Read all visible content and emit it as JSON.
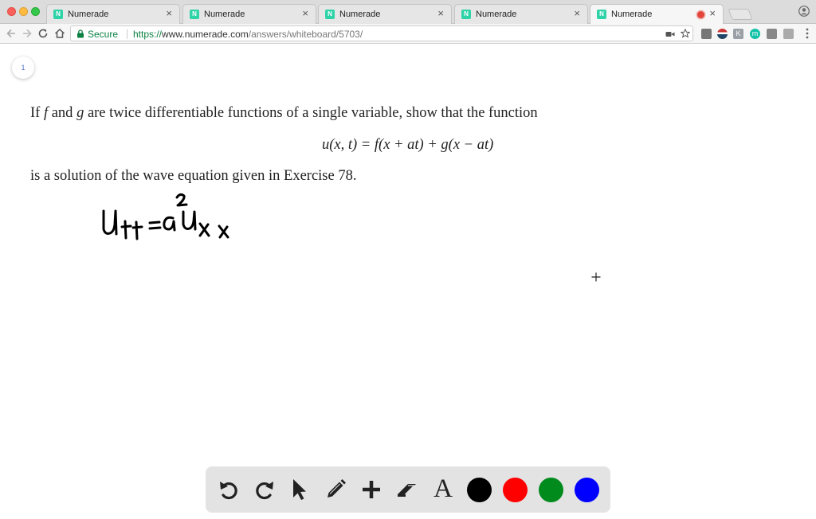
{
  "browser": {
    "tabs": [
      {
        "title": "Numerade",
        "favicon": "N"
      },
      {
        "title": "Numerade",
        "favicon": "N"
      },
      {
        "title": "Numerade",
        "favicon": "N"
      },
      {
        "title": "Numerade",
        "favicon": "N"
      },
      {
        "title": "Numerade",
        "favicon": "N",
        "active": true,
        "recording": true
      }
    ],
    "close_glyph": "×",
    "secure_label": "Secure",
    "url_scheme": "https://",
    "url_host": "www.numerade.com",
    "url_path": "/answers/whiteboard/5703/",
    "extensions": [
      "K",
      "m"
    ],
    "accent_secure": "#0b8043"
  },
  "whiteboard": {
    "page_number": "1",
    "problem": {
      "l1_a": "If ",
      "l1_f": "f",
      "l1_b": " and ",
      "l1_g": "g",
      "l1_c": " are twice differentiable functions of a single variable, show that the function",
      "equation": "u(x, t) = f(x + at) + g(x − at)",
      "l3": "is a solution of the wave equation given in Exercise 78."
    },
    "handwritten": {
      "lhs": "u",
      "lhs_sub": "tt",
      "equals": "=",
      "coef": "a",
      "coef_sup": "2",
      "rhs": "u",
      "rhs_sub": "xx"
    }
  },
  "tools": {
    "items": [
      "undo-icon",
      "redo-icon",
      "pointer-icon",
      "pen-icon",
      "plus-icon",
      "eraser-icon",
      "text-icon"
    ],
    "text_tool_glyph": "A",
    "colors": [
      "#000000",
      "#ff0000",
      "#008b1c",
      "#0000ff"
    ]
  }
}
